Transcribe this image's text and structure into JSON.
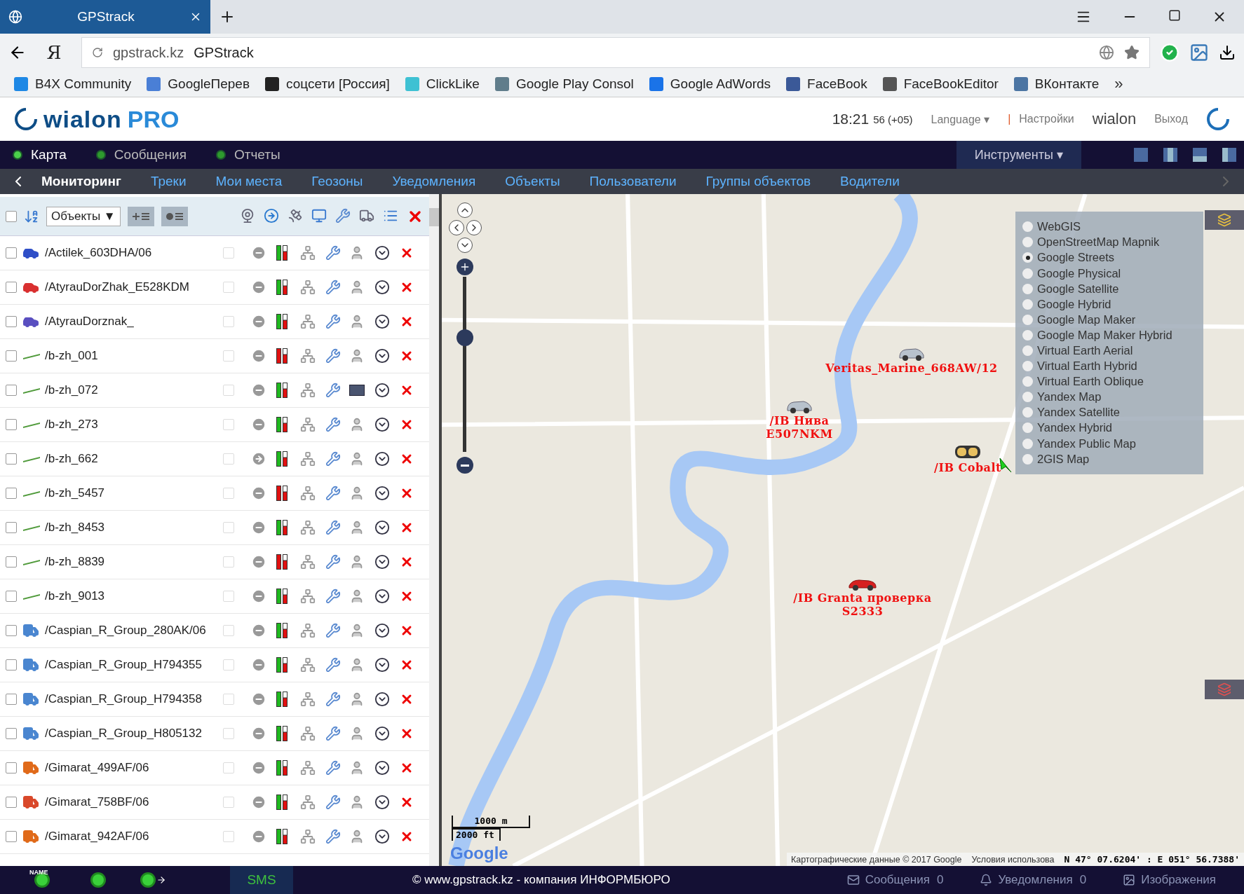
{
  "browser": {
    "tab_title": "GPStrack",
    "address": "gpstrack.kz",
    "page_title": "GPStrack",
    "home_letter": "Я",
    "bookmarks": [
      {
        "label": "B4X Community",
        "color": "#1e88e5"
      },
      {
        "label": "GoogleПерев",
        "color": "#4a7fd6"
      },
      {
        "label": "соцсети [Россия]",
        "color": "#222222"
      },
      {
        "label": "ClickLike",
        "color": "#3ec1d3"
      },
      {
        "label": "Google Play Consol",
        "color": "#607d8b"
      },
      {
        "label": "Google AdWords",
        "color": "#1a73e8"
      },
      {
        "label": "FaceBook",
        "color": "#3b5998"
      },
      {
        "label": "FaceBookEditor",
        "color": "#555555"
      },
      {
        "label": "ВКонтакте",
        "color": "#4c75a3"
      }
    ],
    "more": "»"
  },
  "header": {
    "logo_main": "wialon",
    "logo_suffix": "PRO",
    "time": "18:21",
    "time_suffix": "56 (+05)",
    "language": "Language ▾",
    "separator": "|",
    "settings": "Настройки",
    "user": "wialon",
    "logout": "Выход"
  },
  "nav": {
    "items": [
      {
        "label": "Карта",
        "selected": true
      },
      {
        "label": "Сообщения",
        "selected": false
      },
      {
        "label": "Отчеты",
        "selected": false
      }
    ],
    "tools": "Инструменты ▾"
  },
  "subnav": [
    {
      "label": "Мониторинг",
      "selected": true
    },
    {
      "label": "Треки",
      "selected": false
    },
    {
      "label": "Мои места",
      "selected": false
    },
    {
      "label": "Геозоны",
      "selected": false
    },
    {
      "label": "Уведомления",
      "selected": false
    },
    {
      "label": "Объекты",
      "selected": false
    },
    {
      "label": "Пользователи",
      "selected": false
    },
    {
      "label": "Группы объектов",
      "selected": false
    },
    {
      "label": "Водители",
      "selected": false
    }
  ],
  "list": {
    "select_all_checked": false,
    "filter": "Объекты ▼",
    "units": [
      {
        "name": "/Actilek_603DHA/06",
        "kind": "car",
        "color": "#2f4fc7",
        "checked": false,
        "visible": false,
        "moving": false,
        "ignition": true,
        "driver_photo": false
      },
      {
        "name": "/AtyrauDorZhak_E528KDM",
        "kind": "car",
        "color": "#d93030",
        "checked": false,
        "visible": false,
        "moving": false,
        "ignition": true,
        "driver_photo": false
      },
      {
        "name": "/AtyrauDorznak_",
        "kind": "car",
        "color": "#5a4fc0",
        "checked": false,
        "visible": false,
        "moving": false,
        "ignition": true,
        "driver_photo": false
      },
      {
        "name": "/b-zh_001",
        "kind": "platform",
        "color": "#4f9a3a",
        "checked": false,
        "visible": false,
        "moving": false,
        "ignition": false,
        "driver_photo": false
      },
      {
        "name": "/b-zh_072",
        "kind": "platform",
        "color": "#4f9a3a",
        "checked": false,
        "visible": false,
        "moving": false,
        "ignition": true,
        "driver_photo": true
      },
      {
        "name": "/b-zh_273",
        "kind": "platform",
        "color": "#4f9a3a",
        "checked": false,
        "visible": false,
        "moving": false,
        "ignition": true,
        "driver_photo": false
      },
      {
        "name": "/b-zh_662",
        "kind": "platform",
        "color": "#4f9a3a",
        "checked": false,
        "visible": false,
        "moving": true,
        "ignition": true,
        "driver_photo": false
      },
      {
        "name": "/b-zh_5457",
        "kind": "platform",
        "color": "#4f9a3a",
        "checked": false,
        "visible": false,
        "moving": false,
        "ignition": false,
        "driver_photo": false
      },
      {
        "name": "/b-zh_8453",
        "kind": "platform",
        "color": "#4f9a3a",
        "checked": false,
        "visible": false,
        "moving": false,
        "ignition": true,
        "driver_photo": false
      },
      {
        "name": "/b-zh_8839",
        "kind": "platform",
        "color": "#4f9a3a",
        "checked": false,
        "visible": false,
        "moving": false,
        "ignition": false,
        "driver_photo": false
      },
      {
        "name": "/b-zh_9013",
        "kind": "platform",
        "color": "#4f9a3a",
        "checked": false,
        "visible": false,
        "moving": false,
        "ignition": true,
        "driver_photo": false
      },
      {
        "name": "/Caspian_R_Group_280AK/06",
        "kind": "truck",
        "color": "#4a86d0",
        "checked": false,
        "visible": false,
        "moving": false,
        "ignition": true,
        "driver_photo": false
      },
      {
        "name": "/Caspian_R_Group_H794355",
        "kind": "truck",
        "color": "#4a86d0",
        "checked": false,
        "visible": false,
        "moving": false,
        "ignition": true,
        "driver_photo": false
      },
      {
        "name": "/Caspian_R_Group_H794358",
        "kind": "truck",
        "color": "#4a86d0",
        "checked": false,
        "visible": false,
        "moving": false,
        "ignition": true,
        "driver_photo": false
      },
      {
        "name": "/Caspian_R_Group_H805132",
        "kind": "truck",
        "color": "#4a86d0",
        "checked": false,
        "visible": false,
        "moving": false,
        "ignition": true,
        "driver_photo": false
      },
      {
        "name": "/Gimarat_499AF/06",
        "kind": "truck",
        "color": "#e06a1a",
        "checked": false,
        "visible": false,
        "moving": false,
        "ignition": true,
        "driver_photo": false
      },
      {
        "name": "/Gimarat_758BF/06",
        "kind": "truck",
        "color": "#d9482a",
        "checked": false,
        "visible": false,
        "moving": false,
        "ignition": true,
        "driver_photo": false
      },
      {
        "name": "/Gimarat_942AF/06",
        "kind": "truck",
        "color": "#e06a1a",
        "checked": false,
        "visible": false,
        "moving": false,
        "ignition": true,
        "driver_photo": false
      }
    ]
  },
  "map": {
    "zoom": {
      "level": 0.67
    },
    "layers": [
      {
        "label": "WebGIS",
        "selected": false
      },
      {
        "label": "OpenStreetMap Mapnik",
        "selected": false
      },
      {
        "label": "Google Streets",
        "selected": true
      },
      {
        "label": "Google Physical",
        "selected": false
      },
      {
        "label": "Google Satellite",
        "selected": false
      },
      {
        "label": "Google Hybrid",
        "selected": false
      },
      {
        "label": "Google Map Maker",
        "selected": false
      },
      {
        "label": "Google Map Maker Hybrid",
        "selected": false
      },
      {
        "label": "Virtual Earth Aerial",
        "selected": false
      },
      {
        "label": "Virtual Earth Hybrid",
        "selected": false
      },
      {
        "label": "Virtual Earth Oblique",
        "selected": false
      },
      {
        "label": "Yandex Map",
        "selected": false
      },
      {
        "label": "Yandex Satellite",
        "selected": false
      },
      {
        "label": "Yandex Hybrid",
        "selected": false
      },
      {
        "label": "Yandex Public Map",
        "selected": false
      },
      {
        "label": "2GIS Map",
        "selected": false
      }
    ],
    "markers": [
      {
        "label": "/IB Нива E507NKM",
        "kind": "sedan",
        "moving": false
      },
      {
        "label": "/IB Cobalt",
        "kind": "mask",
        "moving": true
      },
      {
        "label": "/IB Granta проверка S2333",
        "kind": "sport",
        "moving": false
      },
      {
        "label": "Veritas_Marine_668AW/12",
        "kind": "sedan",
        "moving": false
      }
    ],
    "scale_metric": "1000 m",
    "scale_imperial": "2000 ft",
    "provider_logo": "Google",
    "copyright": "Картографические данные © 2017 Google",
    "terms": "Условия использова",
    "coordinates": "N 47° 07.6204' : E 051° 56.7388'"
  },
  "status_bar": {
    "name_tag": "NAME",
    "sms": "SMS",
    "credit": "© www.gpstrack.kz - компания ИНФОРМБЮРО",
    "messages": "Сообщения",
    "messages_count": "0",
    "notifications": "Уведомления",
    "notifications_count": "0",
    "images": "Изображения"
  }
}
